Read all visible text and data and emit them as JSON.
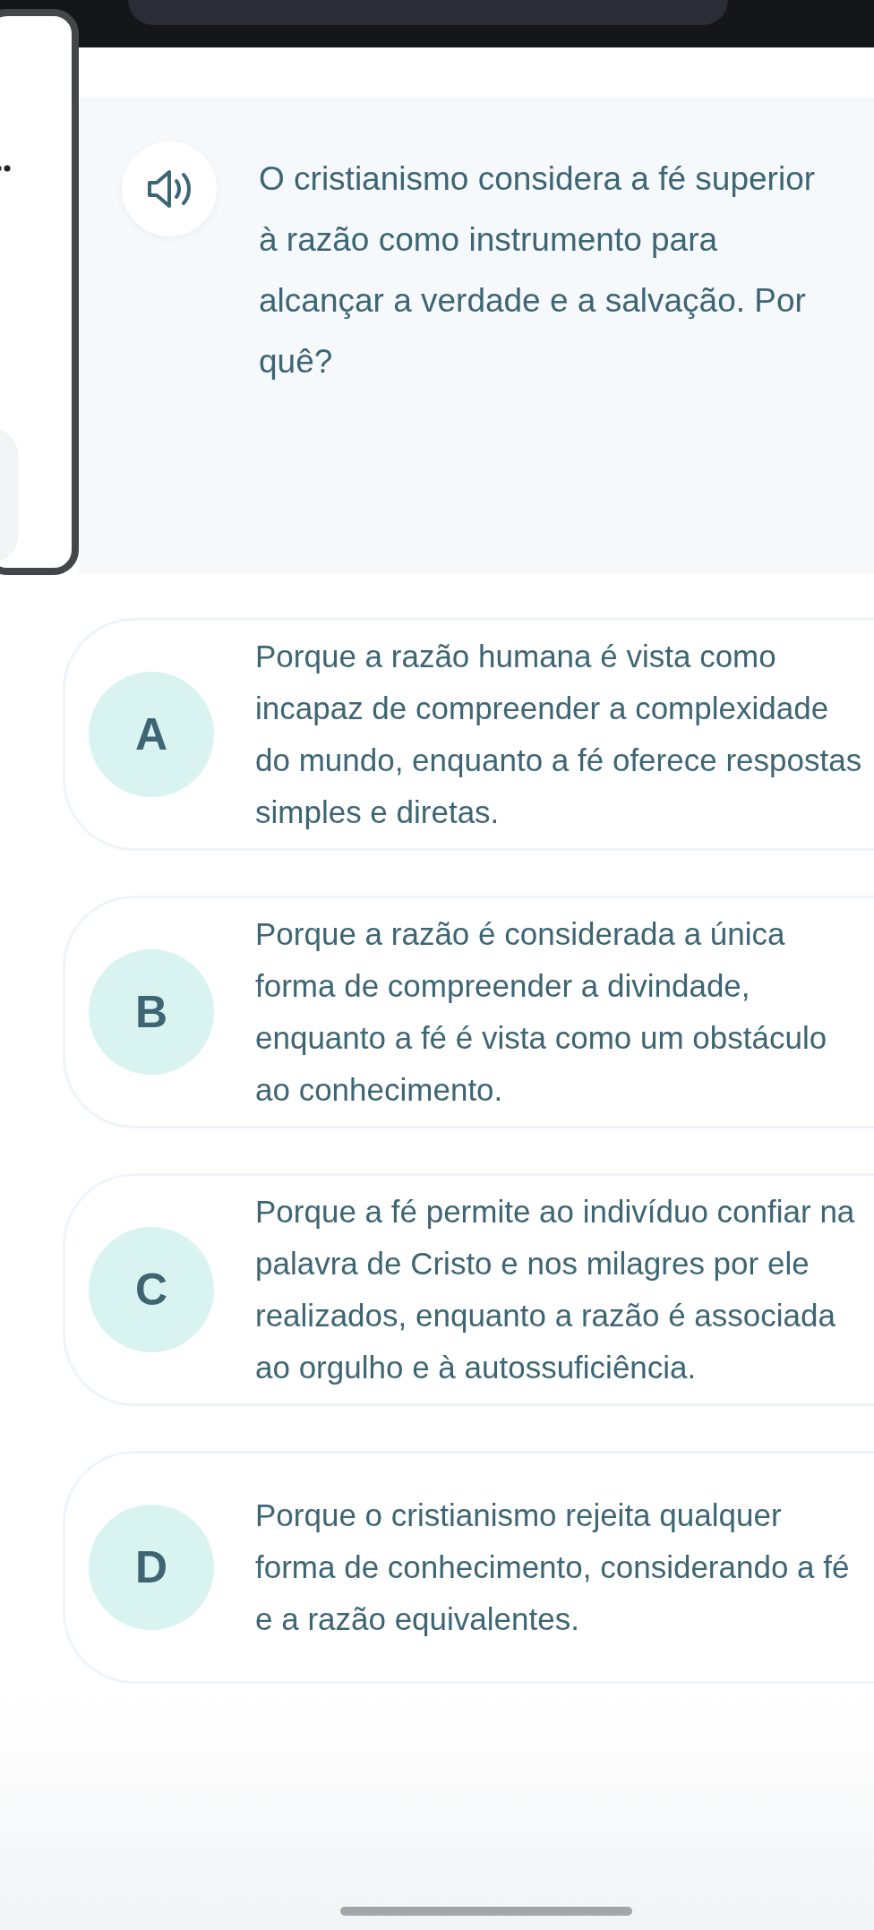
{
  "question": {
    "text": "O cristianismo considera a fé superior à razão como instrumento para alcançar a verdade e a salvação. Por quê?"
  },
  "options": [
    {
      "letter": "A",
      "text": "Porque a razão humana é vista como incapaz de compreender a complexidade do mundo, enquanto a fé oferece respostas simples e diretas."
    },
    {
      "letter": "B",
      "text": "Porque a razão é considerada a única forma de compreender a divindade, enquanto a fé é vista como um obstáculo ao conhecimento."
    },
    {
      "letter": "C",
      "text": "Porque a fé permite ao indivíduo confiar na palavra de Cristo e nos milagres por ele realizados, enquanto a razão é associada ao orgulho e à autossuficiência."
    },
    {
      "letter": "D",
      "text": "Porque o cristianismo rejeita qualquer forma de conhecimento, considerando a fé e a razão equivalentes."
    }
  ]
}
